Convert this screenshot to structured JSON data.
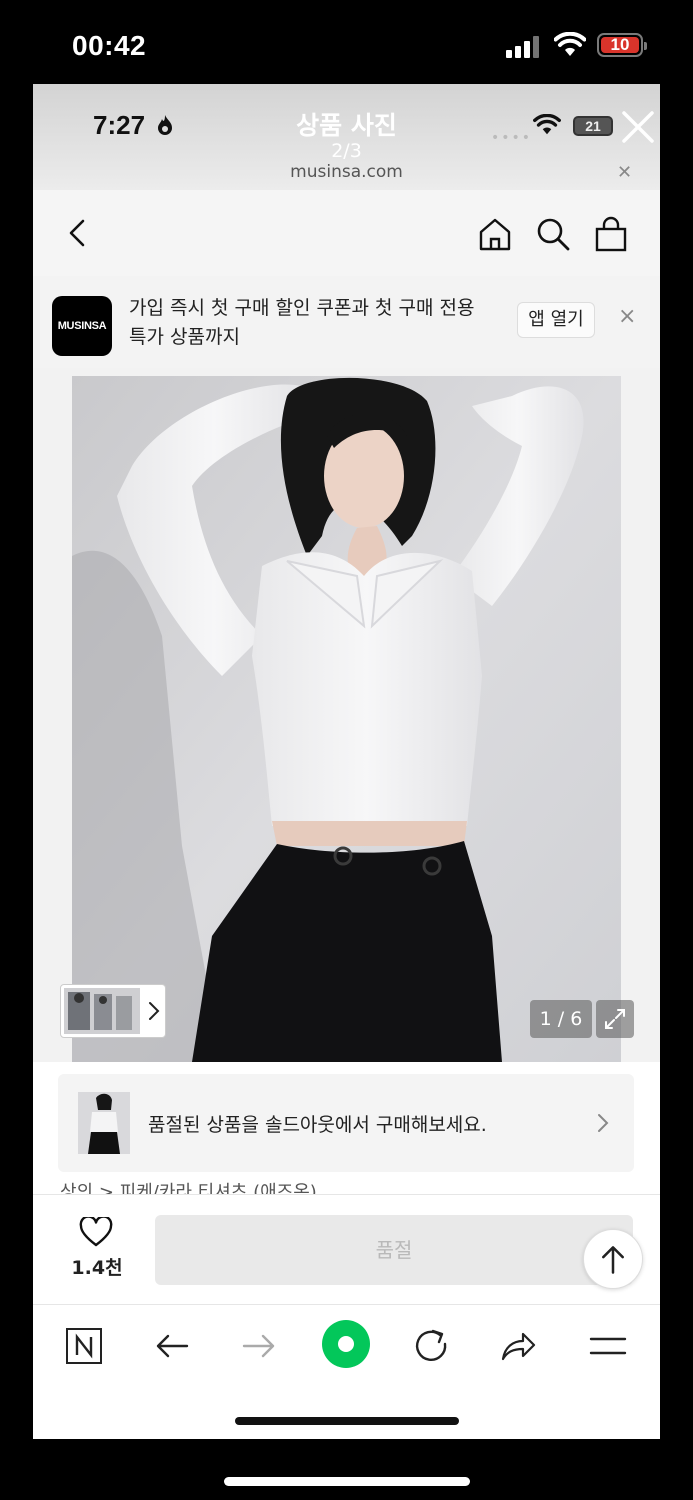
{
  "outer_status": {
    "time": "00:42",
    "battery": "10",
    "battery_color": "#d9342b"
  },
  "viewer": {
    "title": "상품 사진",
    "counter": "2/3",
    "inner_time": "7:27",
    "inner_battery": "21",
    "domain": "musinsa.com",
    "close_icon": "close-icon"
  },
  "site_nav": {
    "icons": [
      "back-arrow-icon",
      "home-icon",
      "search-icon",
      "shopping-bag-icon"
    ]
  },
  "promo": {
    "logo": "MUSINSA",
    "text_line1": "가입 즉시 첫 구매 할인 쿠폰과 첫 구매 전용",
    "text_line2": "특가 상품까지",
    "app_button": "앱 열기",
    "close": "×"
  },
  "photo": {
    "page_indicator": "1 / 6"
  },
  "soldout_card": {
    "text": "품절된 상품을 솔드아웃에서 구매해보세요."
  },
  "breadcrumb": "상의 > 피케/카라 티셔츠 (애즈온)",
  "action_bar": {
    "like_count": "1.4천",
    "main_button": "품절"
  },
  "browser_bar": {
    "icons": [
      "naver-n-icon",
      "back-icon",
      "forward-icon",
      "green-circle-icon",
      "reload-icon",
      "share-icon",
      "menu-icon"
    ],
    "accent": "#03c75a"
  }
}
